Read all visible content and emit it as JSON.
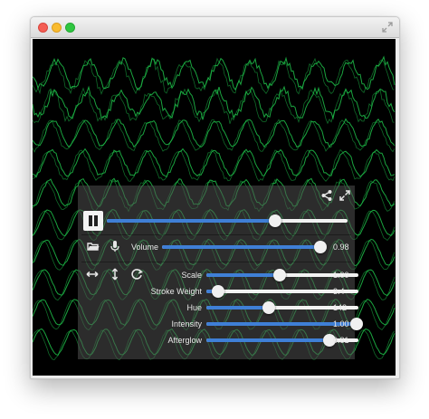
{
  "colors": {
    "wave": "#1ec24a",
    "accent": "#3f7fd6",
    "canvas": "#000000"
  },
  "window": {
    "buttons": [
      "close",
      "minimize",
      "zoom"
    ],
    "fullscreen_icon": "fullscreen-arrows-icon"
  },
  "panel": {
    "top_icons": [
      "share-icon",
      "expand-icon"
    ],
    "playback": {
      "state": "playing",
      "icon": "pause-icon",
      "progress": 0.7
    },
    "source_icons": [
      "folder-icon",
      "microphone-icon"
    ],
    "volume": {
      "label": "Volume",
      "value": "0.98",
      "fraction": 0.98
    },
    "tool_icons": [
      "horizontal-arrows-icon",
      "vertical-arrows-icon",
      "rotate-icon"
    ],
    "sliders": [
      {
        "key": "scale",
        "label": "Scale",
        "value": "1.00",
        "fraction": 0.48
      },
      {
        "key": "stroke-weight",
        "label": "Stroke Weight",
        "value": "3.4",
        "fraction": 0.08
      },
      {
        "key": "hue",
        "label": "Hue",
        "value": "142",
        "fraction": 0.41
      },
      {
        "key": "intensity",
        "label": "Intensity",
        "value": "1.00",
        "fraction": 0.99
      },
      {
        "key": "afterglow",
        "label": "Afterglow",
        "value": "0.81",
        "fraction": 0.81
      }
    ]
  }
}
